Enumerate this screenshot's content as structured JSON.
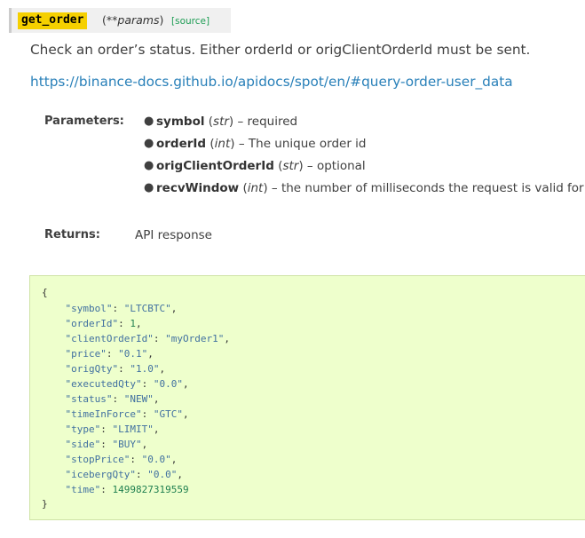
{
  "signature": {
    "name": "get_order",
    "open_paren": "(",
    "params": "**params",
    "close_paren": ")",
    "source_link": "[source]"
  },
  "description": "Check an order’s status. Either orderId or origClientOrderId must be sent.",
  "doc_link": "https://binance-docs.github.io/apidocs/spot/en/#query-order-user_data",
  "parameters": {
    "label": "Parameters:",
    "items": [
      {
        "name": "symbol",
        "open": " (",
        "type": "str",
        "close": ")",
        "desc": " – required"
      },
      {
        "name": "orderId",
        "open": " (",
        "type": "int",
        "close": ")",
        "desc": " – The unique order id"
      },
      {
        "name": "origClientOrderId",
        "open": " (",
        "type": "str",
        "close": ")",
        "desc": " – optional"
      },
      {
        "name": "recvWindow",
        "open": " (",
        "type": "int",
        "close": ")",
        "desc": " – the number of milliseconds the request is valid for"
      }
    ]
  },
  "returns": {
    "label": "Returns:",
    "value": "API response"
  },
  "code": {
    "open_brace": "{",
    "close_brace": "}",
    "lines": [
      {
        "key": "\"symbol\"",
        "sep": ": ",
        "value": "\"LTCBTC\"",
        "kind": "str",
        "end": ","
      },
      {
        "key": "\"orderId\"",
        "sep": ": ",
        "value": "1",
        "kind": "num",
        "end": ","
      },
      {
        "key": "\"clientOrderId\"",
        "sep": ": ",
        "value": "\"myOrder1\"",
        "kind": "str",
        "end": ","
      },
      {
        "key": "\"price\"",
        "sep": ": ",
        "value": "\"0.1\"",
        "kind": "str",
        "end": ","
      },
      {
        "key": "\"origQty\"",
        "sep": ": ",
        "value": "\"1.0\"",
        "kind": "str",
        "end": ","
      },
      {
        "key": "\"executedQty\"",
        "sep": ": ",
        "value": "\"0.0\"",
        "kind": "str",
        "end": ","
      },
      {
        "key": "\"status\"",
        "sep": ": ",
        "value": "\"NEW\"",
        "kind": "str",
        "end": ","
      },
      {
        "key": "\"timeInForce\"",
        "sep": ": ",
        "value": "\"GTC\"",
        "kind": "str",
        "end": ","
      },
      {
        "key": "\"type\"",
        "sep": ": ",
        "value": "\"LIMIT\"",
        "kind": "str",
        "end": ","
      },
      {
        "key": "\"side\"",
        "sep": ": ",
        "value": "\"BUY\"",
        "kind": "str",
        "end": ","
      },
      {
        "key": "\"stopPrice\"",
        "sep": ": ",
        "value": "\"0.0\"",
        "kind": "str",
        "end": ","
      },
      {
        "key": "\"icebergQty\"",
        "sep": ": ",
        "value": "\"0.0\"",
        "kind": "str",
        "end": ","
      },
      {
        "key": "\"time\"",
        "sep": ": ",
        "value": "1499827319559",
        "kind": "num",
        "end": ""
      }
    ]
  },
  "colors": {
    "name_highlight": "#f5d000",
    "link": "#2980b9",
    "source_link": "#1f9d55",
    "code_background": "#eeffcc"
  }
}
